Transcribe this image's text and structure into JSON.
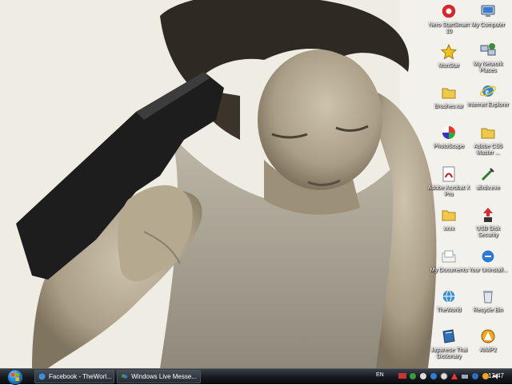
{
  "desktop_icons": [
    {
      "id": "nero",
      "icon": "nero-icon",
      "label": "Nero StartSmart 10"
    },
    {
      "id": "mycomputer",
      "icon": "computer-icon",
      "label": "My Computer"
    },
    {
      "id": "msnstar",
      "icon": "star-icon",
      "label": "MsnStar"
    },
    {
      "id": "networkplaces",
      "icon": "network-icon",
      "label": "My Network Places"
    },
    {
      "id": "brushes",
      "icon": "folder-icon",
      "label": "Brushes.rar"
    },
    {
      "id": "ie",
      "icon": "internet-explorer-icon",
      "label": "Internet Explorer"
    },
    {
      "id": "photoscape",
      "icon": "photoscape-icon",
      "label": "PhotoScape"
    },
    {
      "id": "adobecs5",
      "icon": "folder-icon",
      "label": "Adobe CS5 Master ..."
    },
    {
      "id": "acrobat",
      "icon": "pdf-icon",
      "label": "Adobe Acrobat X Pro"
    },
    {
      "id": "afxdv",
      "icon": "exe-icon",
      "label": "afxdv.exe"
    },
    {
      "id": "xxxx",
      "icon": "folder-icon",
      "label": "xxxx"
    },
    {
      "id": "usbsecurity",
      "icon": "usb-icon",
      "label": "USB Disk Security"
    },
    {
      "id": "mydocuments",
      "icon": "documents-icon",
      "label": "My Documents"
    },
    {
      "id": "uninstaller",
      "icon": "uninstaller-icon",
      "label": "Your Uninstall..."
    },
    {
      "id": "theworld",
      "icon": "globe-icon",
      "label": "TheWorld"
    },
    {
      "id": "recyclebin",
      "icon": "recycle-bin-icon",
      "label": "Recycle Bin"
    },
    {
      "id": "dictionary",
      "icon": "dictionary-icon",
      "label": "Japanese Thai Dictionary"
    },
    {
      "id": "aimp",
      "icon": "aimp-icon",
      "label": "AIMP2"
    }
  ],
  "taskbar": {
    "tasks": [
      {
        "label": "Facebook - TheWorl...",
        "icon": "globe-icon"
      },
      {
        "label": "Windows Live Messe...",
        "icon": "messenger-icon"
      }
    ],
    "language": "EN",
    "clock": "13:47"
  },
  "colors": {
    "taskbar": "#15181d",
    "icon_label": "#ffffff"
  }
}
